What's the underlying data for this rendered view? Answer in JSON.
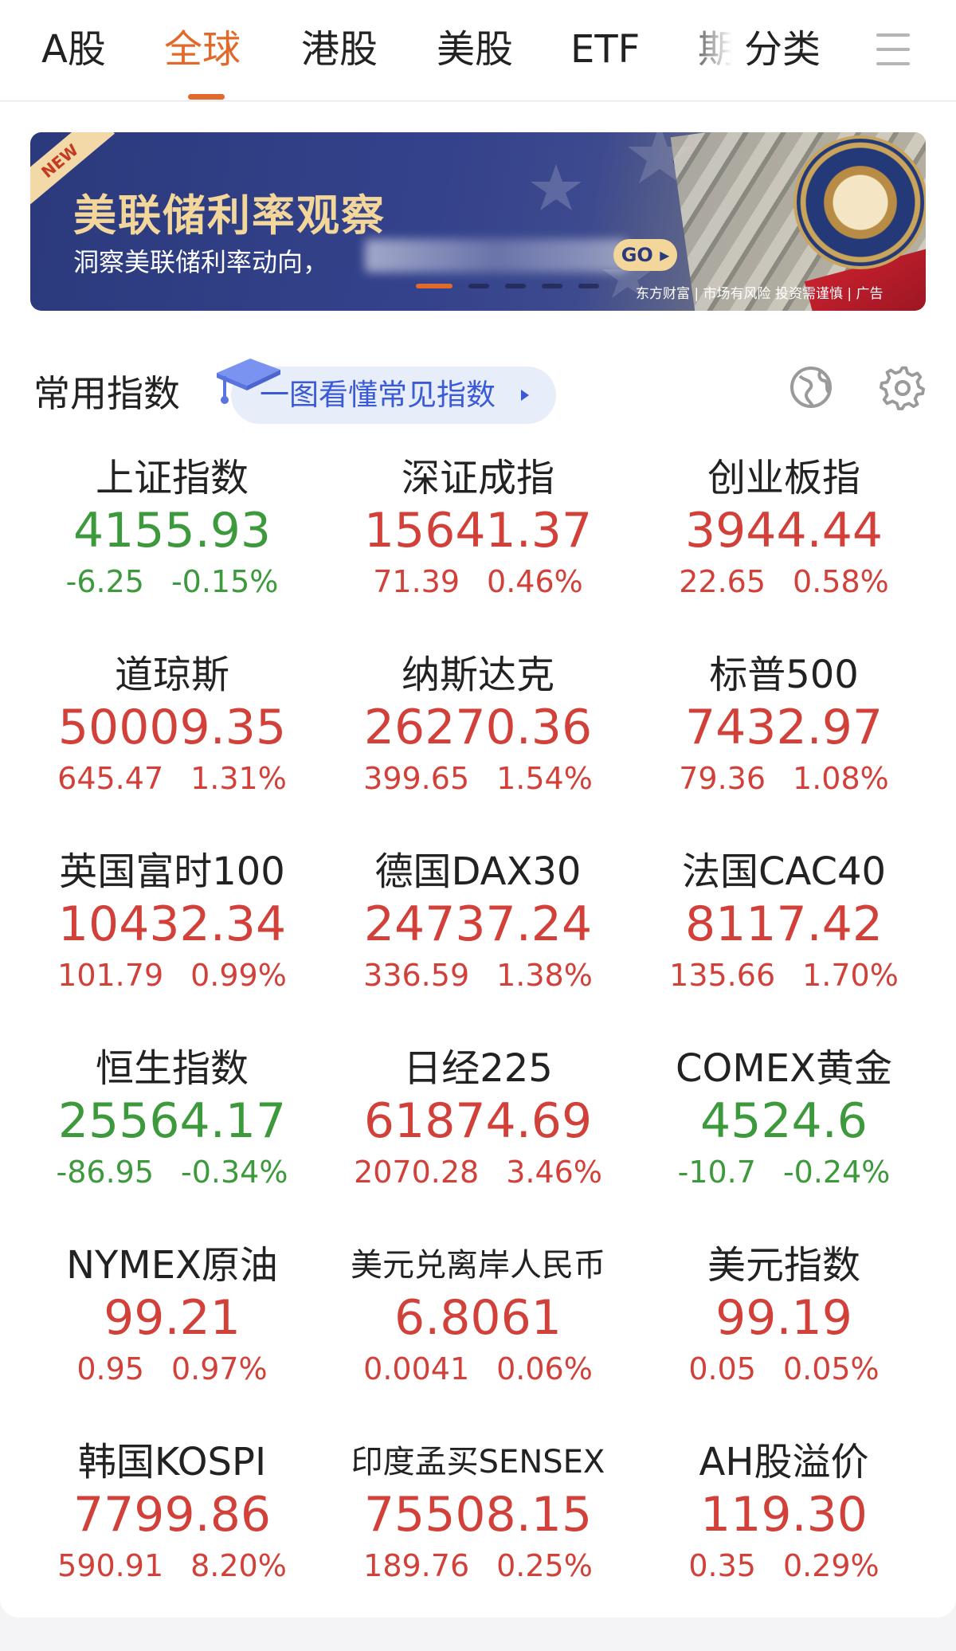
{
  "tabs": [
    {
      "label": "A股",
      "active": false
    },
    {
      "label": "全球",
      "active": true
    },
    {
      "label": "港股",
      "active": false
    },
    {
      "label": "美股",
      "active": false
    },
    {
      "label": "ETF",
      "active": false
    },
    {
      "label": "期",
      "active": false
    },
    {
      "label": "分类",
      "active": false
    }
  ],
  "banner": {
    "badge": "NEW",
    "title": "美联储利率观察",
    "subtitle": "洞察美联储利率动向，",
    "go_label": "GO",
    "ad_note": "东方财富 | 市场有风险 投资需谨慎 | 广告"
  },
  "indices": {
    "section_title": "常用指数",
    "guide_label": "一图看懂常见指数",
    "items": [
      {
        "name": "上证指数",
        "price": "4155.93",
        "change": "-6.25",
        "pct": "-0.15%",
        "dir": "down"
      },
      {
        "name": "深证成指",
        "price": "15641.37",
        "change": "71.39",
        "pct": "0.46%",
        "dir": "up"
      },
      {
        "name": "创业板指",
        "price": "3944.44",
        "change": "22.65",
        "pct": "0.58%",
        "dir": "up"
      },
      {
        "name": "道琼斯",
        "price": "50009.35",
        "change": "645.47",
        "pct": "1.31%",
        "dir": "up"
      },
      {
        "name": "纳斯达克",
        "price": "26270.36",
        "change": "399.65",
        "pct": "1.54%",
        "dir": "up"
      },
      {
        "name": "标普500",
        "price": "7432.97",
        "change": "79.36",
        "pct": "1.08%",
        "dir": "up"
      },
      {
        "name": "英国富时100",
        "price": "10432.34",
        "change": "101.79",
        "pct": "0.99%",
        "dir": "up"
      },
      {
        "name": "德国DAX30",
        "price": "24737.24",
        "change": "336.59",
        "pct": "1.38%",
        "dir": "up"
      },
      {
        "name": "法国CAC40",
        "price": "8117.42",
        "change": "135.66",
        "pct": "1.70%",
        "dir": "up"
      },
      {
        "name": "恒生指数",
        "price": "25564.17",
        "change": "-86.95",
        "pct": "-0.34%",
        "dir": "down"
      },
      {
        "name": "日经225",
        "price": "61874.69",
        "change": "2070.28",
        "pct": "3.46%",
        "dir": "up"
      },
      {
        "name": "COMEX黄金",
        "price": "4524.6",
        "change": "-10.7",
        "pct": "-0.24%",
        "dir": "down"
      },
      {
        "name": "NYMEX原油",
        "price": "99.21",
        "change": "0.95",
        "pct": "0.97%",
        "dir": "up"
      },
      {
        "name": "美元兑离岸人民币",
        "price": "6.8061",
        "change": "0.0041",
        "pct": "0.06%",
        "dir": "up"
      },
      {
        "name": "美元指数",
        "price": "99.19",
        "change": "0.05",
        "pct": "0.05%",
        "dir": "up"
      },
      {
        "name": "韩国KOSPI",
        "price": "7799.86",
        "change": "590.91",
        "pct": "8.20%",
        "dir": "up"
      },
      {
        "name": "印度孟买SENSEX",
        "price": "75508.15",
        "change": "189.76",
        "pct": "0.25%",
        "dir": "up"
      },
      {
        "name": "AH股溢价",
        "price": "119.30",
        "change": "0.35",
        "pct": "0.29%",
        "dir": "up"
      }
    ]
  },
  "colors": {
    "accent": "#e0692b",
    "up": "#d2403a",
    "down": "#3c9a3c",
    "link": "#3b5bd6"
  },
  "icons": [
    "menu-icon",
    "graduation-cap-icon",
    "globe-icon",
    "gear-icon",
    "play-arrow-icon"
  ]
}
